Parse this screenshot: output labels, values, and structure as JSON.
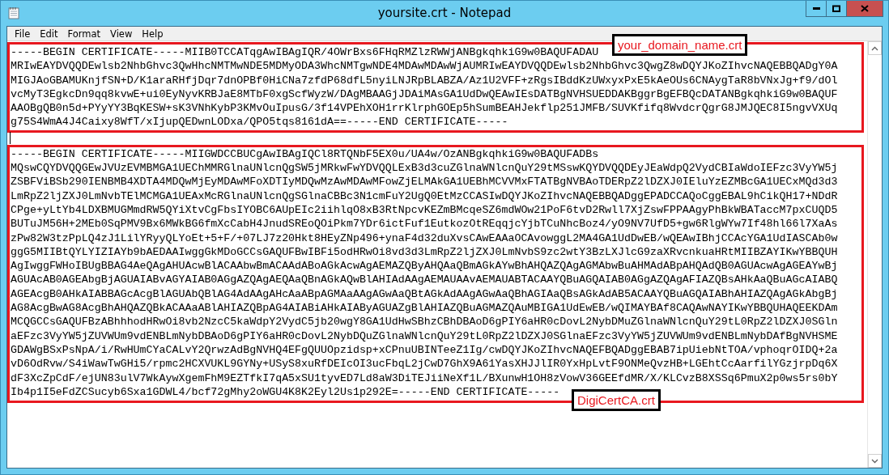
{
  "window": {
    "title": "yoursite.crt - Notepad"
  },
  "menu": [
    "File",
    "Edit",
    "Format",
    "View",
    "Help"
  ],
  "certificates": [
    {
      "label": "your_domain_name.crt",
      "lines": [
        "-----BEGIN CERTIFICATE-----MIIB0TCCATqgAwIBAgIQR/4OWrBxs6FHqRMZlzRWWjANBgkqhkiG9w0BAQUFADAU",
        "MRIwEAYDVQQDEwlsb2NhbGhvc3QwHhcNMTMwNDE5MDMyODA3WhcNMTgwNDE4MDAwMDAwWjAUMRIwEAYDVQQDEwlsb2NhbGhvc3QwgZ8wDQYJKoZIhvcNAQEBBQADgY0A",
        "MIGJAoGBAMUKnjfSN+D/K1araRHfjDqr7dnOPBf0HiCNa7zfdP68dfL5nyiLNJRpBLABZA/Az1U2VFF+zRgsIBddKzUWxyxPxE5kAeOUs6CNAygTaR8bVNxJg+f9/dOl",
        "vcMyT3EgkcDn9qq8kvwE+ui0EyNyvKRBJaE8MTbF0xgScfWyzW/DAgMBAAGjJDAiMAsGA1UdDwQEAwIEsDATBgNVHSUEDDAKBggrBgEFBQcDATANBgkqhkiG9w0BAQUF",
        "AAOBgQB0n5d+PYyYY3BqKESW+sK3VNhKybP3KMvOuIpusG/3f14VPEhXOH1rrKlrphGOEp5hSumBEAHJekflp251JMFB/SUVKfifq8WvdcrQgrG8JMJQEC8I5ngvVXUq",
        "g75S4WmA4J4Caixy8WfT/xIjupQEDwnLODxa/QPO5tqs8161dA==-----END CERTIFICATE-----"
      ]
    },
    {
      "label": "DigiCertCA.crt",
      "lines": [
        "-----BEGIN CERTIFICATE-----MIIGWDCCBUCgAwIBAgIQCl8RTQNbF5EX0u/UA4w/OzANBgkqhkiG9w0BAQUFADBs",
        "MQswCQYDVQQGEwJVUzEVMBMGA1UEChMMRGlnaUNlcnQgSW5jMRkwFwYDVQQLExB3d3cuZGlnaWNlcnQuY29tMSswKQYDVQQDEyJEaWdpQ2VydCBIaWdoIEFzc3VyYW5j",
        "ZSBFViBSb290IENBMB4XDTA4MDQwMjEyMDAwMFoXDTIyMDQwMzAwMDAwMFowZjELMAkGA1UEBhMCVVMxFTATBgNVBAoTDERpZ2lDZXJ0IEluYzEZMBcGA1UECxMQd3d3",
        "LmRpZ2ljZXJ0LmNvbTElMCMGA1UEAxMcRGlnaUNlcnQgSGlnaCBBc3N1cmFuY2UgQ0EtMzCCASIwDQYJKoZIhvcNAQEBBQADggEPADCCAQoCggEBAL9hCikQH17+NDdR",
        "CPge+yLtYb4LDXBMUGMmdRW5QYiXtvCgFbsIYOBC6AUpEIc2iihlqO8xB3RtNpcvKEZmBMcqeSZ6mdWOw21PoF6tvD2Rwll7XjZswFPPAAgyPhBkWBATaccM7pxCUQD5",
        "BUTuJM56H+2MEb0SqPMV9Bx6MWkBG6fmXcCabH4JnudSREoQOiPkm7YDr6ictFuf1EutkozOtREqqjcYjbTCuNhcBoz4/yO9NV7UfD5+gw6RlgWYw7If48hl66l7XaAs",
        "zPw82W3tzPpLQ4zJ1LilYRyyQLYoEt+5+F/+07LJ7z20Hkt8HEyZNp496+ynaF4d32duXvsCAwEAAaOCAvowggL2MA4GA1UdDwEB/wQEAwIBhjCCAcYGA1UdIASCAb0w",
        "ggG5MIIBtQYLYIZIAYb9bAEDAAIwggGkMDoGCCsGAQUFBwIBFi5odHRwOi8vd3d3LmRpZ2ljZXJ0LmNvbS9zc2wtY3BzLXJlcG9zaXRvcnkuaHRtMIIBZAYIKwYBBQUH",
        "AgIwggFWHoIBUgBBAG4AeQAgAHUAcwBlACAAbwBmACAAdABoAGkAcwAgAEMAZQByAHQAaQBmAGkAYwBhAHQAZQAgAGMAbwBuAHMAdABpAHQAdQB0AGUAcwAgAGEAYwBj",
        "AGUAcAB0AGEAbgBjAGUAIABvAGYAIAB0AGgAZQAgAEQAaQBnAGkAQwBlAHIAdAAgAEMAUAAvAEMAUABTACAAYQBuAGQAIAB0AGgAZQAgAFIAZQBsAHkAaQBuAGcAIABQ",
        "AGEAcgB0AHkAIABBAGcAcgBlAGUAbQBlAG4AdAAgAHcAaABpAGMAaAAgAGwAaQBtAGkAdAAgAGwAaQBhAGIAaQBsAGkAdAB5ACAAYQBuAGQAIABhAHIAZQAgAGkAbgBj",
        "AG8AcgBwAG8AcgBhAHQAZQBkACAAaABlAHIAZQBpAG4AIABiAHkAIAByAGUAZgBlAHIAZQBuAGMAZQAuMBIGA1UdEwEB/wQIMAYBAf8CAQAwNAYIKwYBBQUHAQEEKDAm",
        "MCQGCCsGAQUFBzABhhhodHRwOi8vb2NzcC5kaWdpY2VydC5jb20wgY8GA1UdHwSBhzCBhDBAoD6gPIY6aHR0cDovL2NybDMuZGlnaWNlcnQuY29tL0RpZ2lDZXJ0SGln",
        "aEFzc3VyYW5jZUVWUm9vdENBLmNybDBAoD6gPIY6aHR0cDovL2NybDQuZGlnaWNlcnQuY29tL0RpZ2lDZXJ0SGlnaEFzc3VyYW5jZUVWUm9vdENBLmNybDAfBgNVHSME",
        "GDAWgBSxPsNpA/i/RwHUmCYaCALvY2QrwzAdBgNVHQ4EFgQUUOpzidsp+xCPnuUBINTeeZ1Ig/cwDQYJKoZIhvcNAQEFBQADggEBAB7ipUiebNtTOA/vphoqrOIDQ+2a",
        "vD6OdRvw/S4iWawTwGHi5/rpmc2HCXVUKL9GYNy+USyS8xuRfDEIcOI3ucFbqL2jCwD7GhX9A61YasXHJJlIR0YxHpLvtF9ONMeQvzHB+LGEhtCcAarfilYGzjrpDq6X",
        "dF3XcZpCdF/ejUN83ulV7WkAywXgemFhM9EZTfkI7qA5xSU1tyvED7Ld8aW3DiTEJiiNeXf1L/BXunwH1OH8zVowV36GEEfdMR/X/KLCvzB8XSSq6PmuX2p0ws5rs0bY",
        "Ib4p1I5eFdZCSucyb6Sxa1GDWL4/bcf72gMhy2oWGU4K8K2Eyl2Us1p292E=-----END CERTIFICATE-----"
      ]
    }
  ]
}
